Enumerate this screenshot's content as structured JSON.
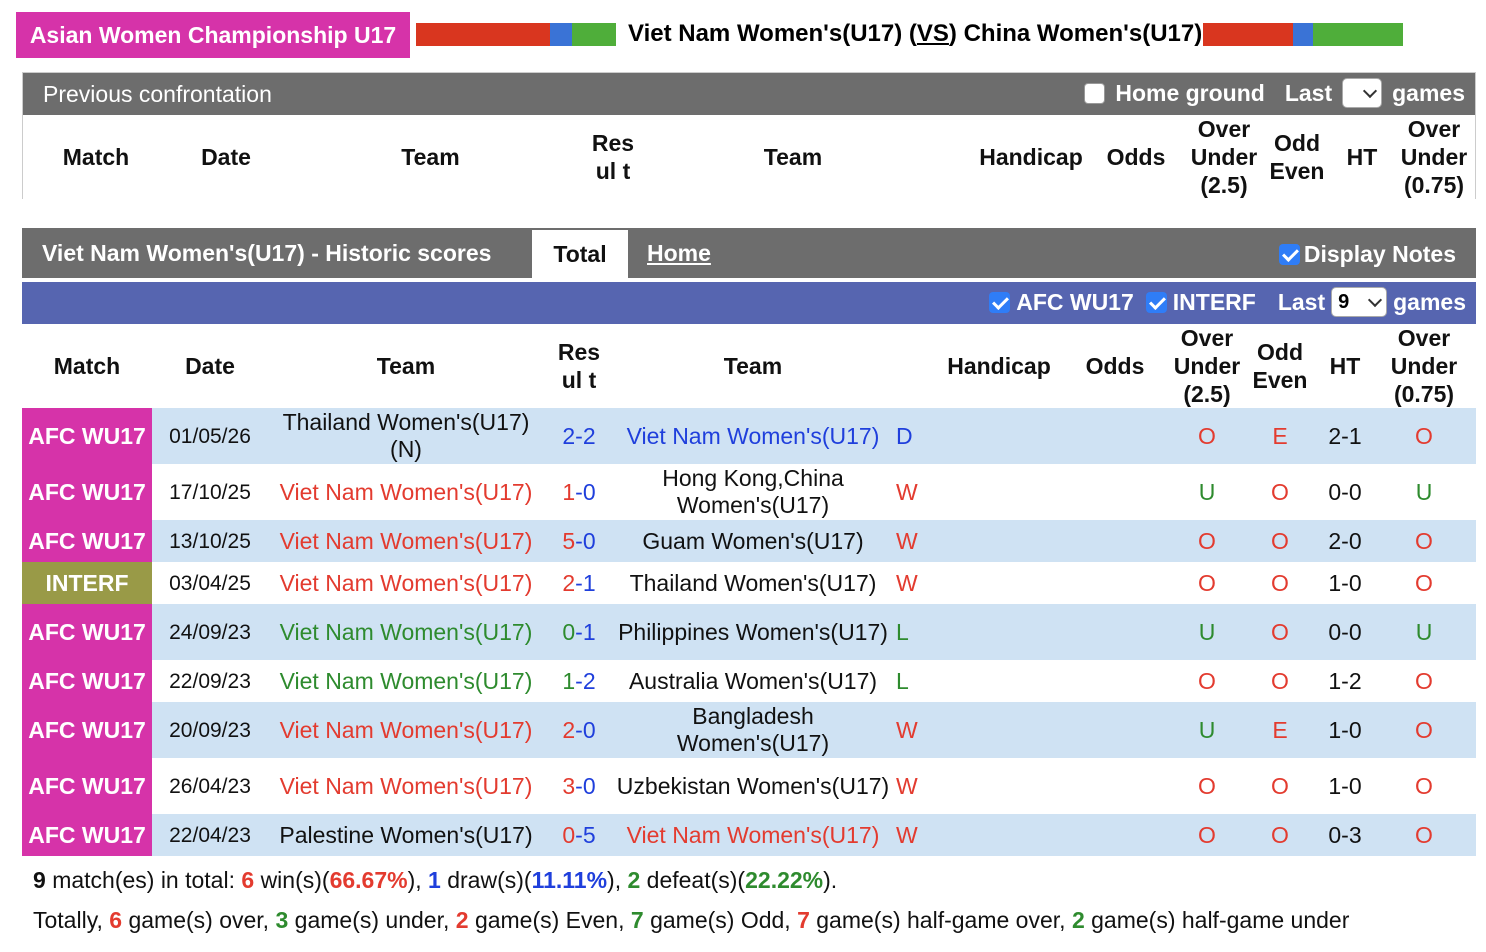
{
  "banner": {
    "league": "Asian Women Championship U17",
    "home_team": "Viet Nam Women's(U17)",
    "vs": "VS",
    "away_team": "China Women's(U17)",
    "bar_colors": [
      "#d9361f",
      "#3a73d6",
      "#4fae3a"
    ]
  },
  "previous": {
    "title": "Previous confrontation",
    "home_ground_label": "Home ground",
    "last_label": "Last",
    "games_label": "games",
    "select_value": ""
  },
  "columns": {
    "match": "Match",
    "date": "Date",
    "team": "Team",
    "result": "Resul t",
    "handicap": "Handicap",
    "odds": "Odds",
    "ou25": "Over Under (2.5)",
    "oddeven": "Odd Even",
    "ht": "HT",
    "ou075": "Over Under (0.75)"
  },
  "historic": {
    "title": "Viet Nam Women's(U17) - Historic scores",
    "tab_total": "Total",
    "tab_home": "Home",
    "display_notes": "Display Notes",
    "filter_afc": "AFC WU17",
    "filter_interf": "INTERF",
    "last_label": "Last",
    "games_count": "9",
    "games_label": "games"
  },
  "colors": {
    "afc": "#d633a9",
    "interf": "#999a47",
    "filter_bar": "#5665b0",
    "win": "#e33b2f",
    "draw": "#1f3fdc",
    "loss": "#2e8b2e"
  },
  "rows": [
    {
      "league": "AFC WU17",
      "date": "01/05/26",
      "home": "Thailand Women's(U17)(N)",
      "home_color": "black",
      "score_home": "2",
      "score_away": "2",
      "score_color": "blue",
      "away": "Viet Nam Women's(U17)",
      "away_color": "blue",
      "res": "D",
      "res_color": "blue",
      "ou": "O",
      "oe": "E",
      "ht": "2-1",
      "ou2": "O"
    },
    {
      "league": "AFC WU17",
      "date": "17/10/25",
      "home": "Viet Nam Women's(U17)",
      "home_color": "red",
      "score_home": "1",
      "score_away": "0",
      "score_color": "red",
      "away": "Hong Kong,China Women's(U17)",
      "away_color": "black",
      "res": "W",
      "res_color": "red",
      "ou": "U",
      "oe": "O",
      "ht": "0-0",
      "ou2": "U"
    },
    {
      "league": "AFC WU17",
      "date": "13/10/25",
      "home": "Viet Nam Women's(U17)",
      "home_color": "red",
      "score_home": "5",
      "score_away": "0",
      "score_color": "red",
      "away": "Guam Women's(U17)",
      "away_color": "black",
      "res": "W",
      "res_color": "red",
      "ou": "O",
      "oe": "O",
      "ht": "2-0",
      "ou2": "O"
    },
    {
      "league": "INTERF",
      "date": "03/04/25",
      "home": "Viet Nam Women's(U17)",
      "home_color": "red",
      "score_home": "2",
      "score_away": "1",
      "score_color": "red",
      "away": "Thailand Women's(U17)",
      "away_color": "black",
      "res": "W",
      "res_color": "red",
      "ou": "O",
      "oe": "O",
      "ht": "1-0",
      "ou2": "O"
    },
    {
      "league": "AFC WU17",
      "date": "24/09/23",
      "home": "Viet Nam Women's(U17)",
      "home_color": "green",
      "score_home": "0",
      "score_away": "1",
      "score_color": "green",
      "away": "Philippines Women's(U17)",
      "away_color": "black",
      "res": "L",
      "res_color": "green",
      "ou": "U",
      "oe": "O",
      "ht": "0-0",
      "ou2": "U"
    },
    {
      "league": "AFC WU17",
      "date": "22/09/23",
      "home": "Viet Nam Women's(U17)",
      "home_color": "green",
      "score_home": "1",
      "score_away": "2",
      "score_color": "green",
      "away": "Australia Women's(U17)",
      "away_color": "black",
      "res": "L",
      "res_color": "green",
      "ou": "O",
      "oe": "O",
      "ht": "1-2",
      "ou2": "O"
    },
    {
      "league": "AFC WU17",
      "date": "20/09/23",
      "home": "Viet Nam Women's(U17)",
      "home_color": "red",
      "score_home": "2",
      "score_away": "0",
      "score_color": "red",
      "away": "Bangladesh Women's(U17)",
      "away_color": "black",
      "res": "W",
      "res_color": "red",
      "ou": "U",
      "oe": "E",
      "ht": "1-0",
      "ou2": "O"
    },
    {
      "league": "AFC WU17",
      "date": "26/04/23",
      "home": "Viet Nam Women's(U17)",
      "home_color": "red",
      "score_home": "3",
      "score_away": "0",
      "score_color": "red",
      "away": "Uzbekistan Women's(U17)",
      "away_color": "black",
      "res": "W",
      "res_color": "red",
      "ou": "O",
      "oe": "O",
      "ht": "1-0",
      "ou2": "O"
    },
    {
      "league": "AFC WU17",
      "date": "22/04/23",
      "home": "Palestine Women's(U17)",
      "home_color": "black",
      "score_home": "0",
      "score_away": "5",
      "score_color": "red",
      "away": "Viet Nam Women's(U17)",
      "away_color": "red",
      "res": "W",
      "res_color": "red",
      "ou": "O",
      "oe": "O",
      "ht": "0-3",
      "ou2": "O"
    }
  ],
  "summary": {
    "total": "9",
    "total_text": "match(es) in total:",
    "wins": "6",
    "wins_text": "win(s)(",
    "win_pct": "66.67%",
    "draws": "1",
    "draws_text": "draw(s)(",
    "draw_pct": "11.11%",
    "defeats": "2",
    "defeats_text": "defeat(s)(",
    "defeat_pct": "22.22%",
    "line2_totally": "Totally,",
    "over": "6",
    "over_text": "game(s) over,",
    "under": "3",
    "under_text": "game(s) under,",
    "even": "2",
    "even_text": "game(s) Even,",
    "odd": "7",
    "odd_text": "game(s) Odd,",
    "half_over": "7",
    "half_over_text": "game(s) half-game over,",
    "half_under": "2",
    "half_under_text": "game(s) half-game under"
  }
}
